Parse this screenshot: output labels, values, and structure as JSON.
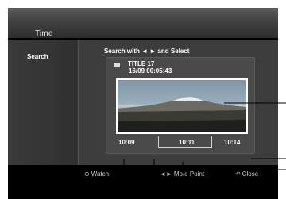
{
  "header": {
    "title": "Time"
  },
  "sidebar": {
    "items": [
      {
        "label": "Search"
      }
    ]
  },
  "main": {
    "instruction": "Search with ◄ ► and Select",
    "title": {
      "name": "TITLE 17",
      "datetime": "16/09   00:05:43"
    },
    "timeline": {
      "left": "10:09",
      "middle": "10:11",
      "right": "10:14"
    }
  },
  "footer": {
    "watch": {
      "glyph": "⊙",
      "label": "Watch"
    },
    "move": {
      "glyph": "◄►",
      "label": "Mo/e Point"
    },
    "close": {
      "glyph": "↶",
      "label": "Close"
    }
  },
  "colors": {
    "screen_bg": "#000000",
    "panel_bg": "#3d3d3d",
    "text": "#ffffff"
  }
}
